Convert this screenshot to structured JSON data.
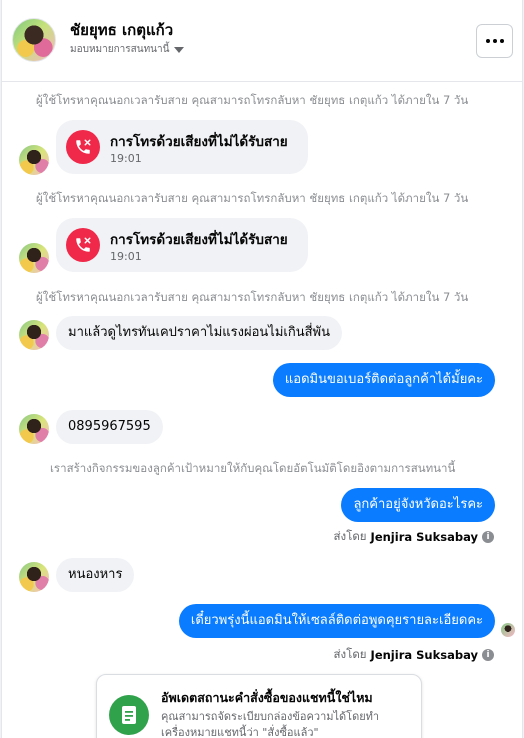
{
  "header": {
    "name": "ชัยยุทธ เกตุแก้ว",
    "sub_label": "มอบหมายการสนทนานี้"
  },
  "system": {
    "missed_notice": "ผู้ใช้โทรหาคุณนอกเวลารับสาย คุณสามารถโทรกลับหา ชัยยุทธ เกตุแก้ว ได้ภายใน 7 วัน",
    "activity_notice": "เราสร้างกิจกรรมของลูกค้าเป้าหมายให้กับคุณโดยอัตโนมัติโดยอิงตามการสนทนานี้"
  },
  "calls": [
    {
      "title": "การโทรด้วยเสียงที่ไม่ได้รับสาย",
      "time": "19:01"
    },
    {
      "title": "การโทรด้วยเสียงที่ไม่ได้รับสาย",
      "time": "19:01"
    }
  ],
  "messages": {
    "in_1": "มาแล้วดูไทรทันเคปราคาไม่แรงผ่อนไม่เกินสี่พัน",
    "out_1": "แอดมินขอเบอร์ติดต่อลูกค้าได้มั้ยคะ",
    "in_2": "0895967595",
    "out_2": "ลูกค้าอยู่จังหวัดอะไรคะ",
    "in_3": "หนองหาร",
    "out_3": "เดี๋ยวพรุ่งนี้แอดมินให้เซลล์ติดต่อพูดคุยรายละเอียดคะ"
  },
  "sent_by": {
    "prefix": "ส่งโดย",
    "agent": "Jenjira Suksabay"
  },
  "card": {
    "title": "อัพเดตสถานะคำสั่งซื้อของแชทนี้ใช่ไหม",
    "text": "คุณสามารถจัดระเบียบกล่องข้อความได้โดยทำเครื่องหมายแชทนี้ว่า \"สั่งซื้อแล้ว\""
  },
  "colors": {
    "accent": "#0a7cff",
    "missed_call": "#f02849",
    "card_icon": "#31a24c"
  },
  "icons": {
    "missed_call": "missed-call-icon",
    "more": "more-icon",
    "info": "info-icon",
    "card": "receipt-icon"
  }
}
